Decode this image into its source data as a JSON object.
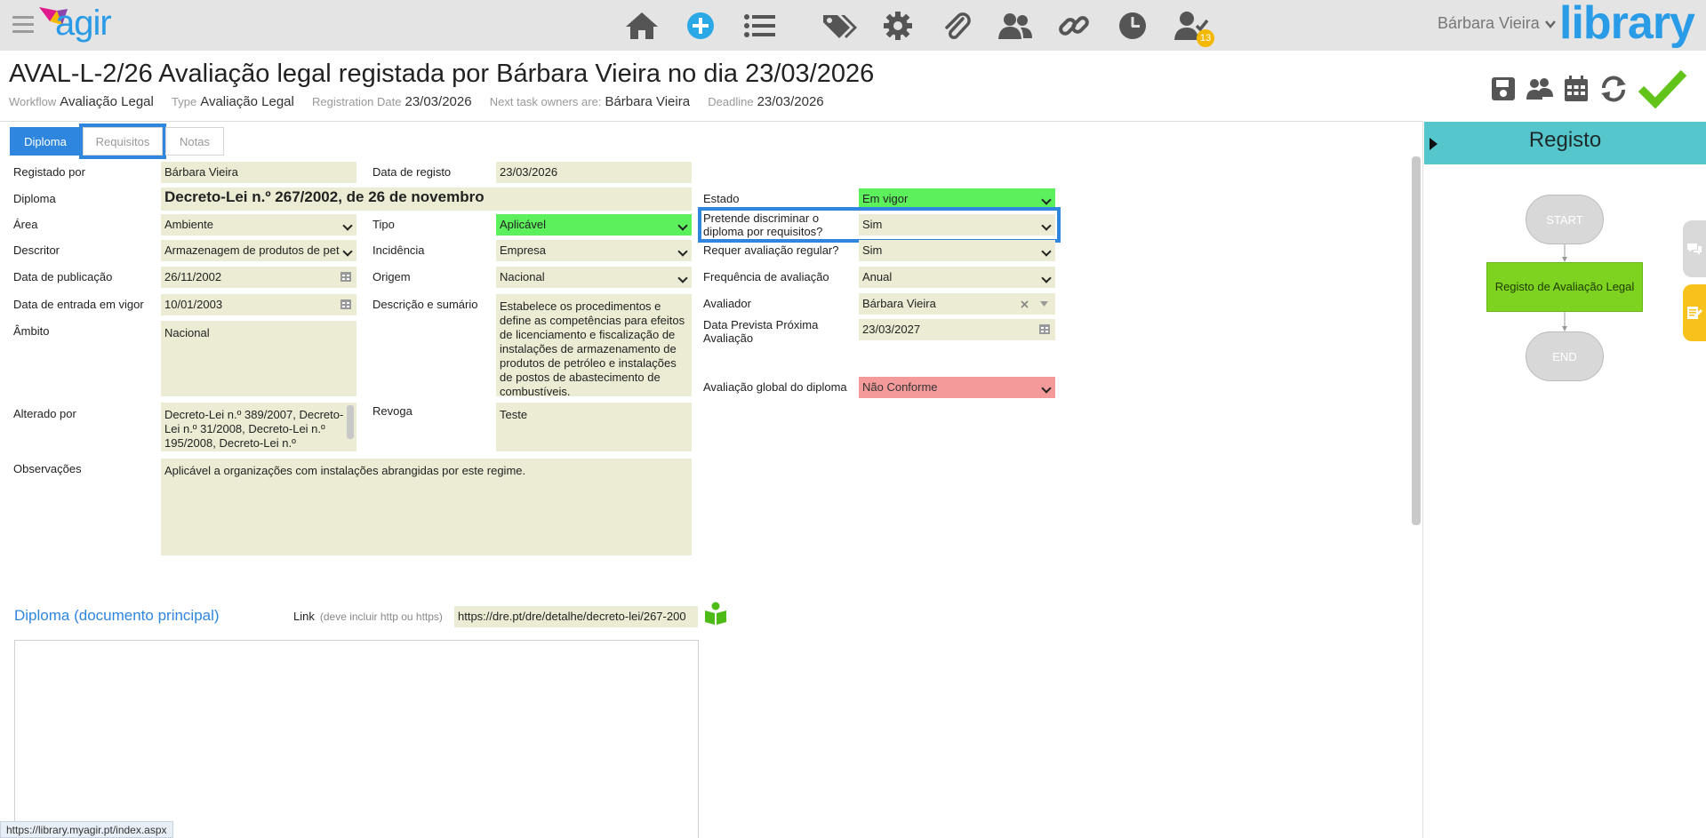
{
  "header": {
    "logo_text": "agir",
    "brand_text": "library",
    "user_name": "Bárbara Vieira",
    "notification_count": "13"
  },
  "nav_icons": [
    "home-icon",
    "add-icon",
    "list-icon",
    "tags-icon",
    "gear-icon",
    "paperclip-icon",
    "users-icon",
    "link-icon",
    "clock-icon",
    "user-check-icon"
  ],
  "record": {
    "title": "AVAL-L-2/26 Avaliação legal registada por Bárbara Vieira no dia 23/03/2026",
    "meta": {
      "workflow_label": "Workflow",
      "workflow_value": "Avaliação Legal",
      "type_label": "Type",
      "type_value": "Avaliação Legal",
      "regdate_label": "Registration Date",
      "regdate_value": "23/03/2026",
      "owners_label": "Next task owners are:",
      "owners_value": "Bárbara Vieira",
      "deadline_label": "Deadline",
      "deadline_value": "23/03/2026"
    }
  },
  "actions": [
    "save-icon",
    "team-icon",
    "calendar-icon",
    "refresh-icon",
    "check-icon"
  ],
  "tabs": [
    {
      "label": "Diploma",
      "active": true
    },
    {
      "label": "Requisitos",
      "active": false
    },
    {
      "label": "Notas",
      "active": false
    }
  ],
  "form": {
    "registado_por": {
      "label": "Registado por",
      "value": "Bárbara Vieira"
    },
    "data_registo": {
      "label": "Data de registo",
      "value": "23/03/2026"
    },
    "diploma": {
      "label": "Diploma",
      "value": "Decreto-Lei n.º 267/2002, de 26 de novembro"
    },
    "estado": {
      "label": "Estado",
      "value": "Em vigor"
    },
    "area": {
      "label": "Área",
      "value": "Ambiente"
    },
    "tipo": {
      "label": "Tipo",
      "value": "Aplicável"
    },
    "discriminar": {
      "label": "Pretende discriminar o diploma por requisitos?",
      "value": "Sim"
    },
    "descritor": {
      "label": "Descritor",
      "value": "Armazenagem de produtos de pet"
    },
    "incidencia": {
      "label": "Incidência",
      "value": "Empresa"
    },
    "requer": {
      "label": "Requer avaliação regular?",
      "value": "Sim"
    },
    "data_publicacao": {
      "label": "Data de publicação",
      "value": "26/11/2002"
    },
    "origem": {
      "label": "Origem",
      "value": "Nacional"
    },
    "frequencia": {
      "label": "Frequência de avaliação",
      "value": "Anual"
    },
    "data_entrada": {
      "label": "Data de entrada em vigor",
      "value": "10/01/2003"
    },
    "descricao": {
      "label": "Descrição e sumário",
      "value": "Estabelece os procedimentos e define as competências para efeitos de licenciamento e fiscalização de instalações de armazenamento de produtos de petróleo e instalações de postos de abastecimento de combustíveis."
    },
    "avaliador": {
      "label": "Avaliador",
      "value": "Bárbara Vieira"
    },
    "data_prevista": {
      "label": "Data Prevista Próxima Avaliação",
      "value": "23/03/2027"
    },
    "ambito": {
      "label": "Âmbito",
      "value": "Nacional"
    },
    "avaliacao_global": {
      "label": "Avaliação global do diploma",
      "value": "Não Conforme"
    },
    "alterado_por": {
      "label": "Alterado por",
      "value": "Decreto-Lei n.º 389/2007, Decreto-Lei n.º 31/2008, Decreto-Lei n.º 195/2008, Decreto-Lei n.º"
    },
    "revoga": {
      "label": "Revoga",
      "value": "Teste"
    },
    "observacoes": {
      "label": "Observações",
      "value": "Aplicável a organizações com instalações abrangidas por este regime."
    }
  },
  "document": {
    "title": "Diploma (documento principal)",
    "link_label": "Link",
    "link_hint": "(deve incluir http ou https)",
    "link_value": "https://dre.pt/dre/detalhe/decreto-lei/267-200"
  },
  "workflow_panel": {
    "title": "Registo",
    "start": "START",
    "task": "Registo de Avaliação Legal",
    "end": "END"
  },
  "status_bar_url": "https://library.myagir.pt/index.aspx",
  "colors": {
    "accent": "#2e86de",
    "field_bg": "#ececd4",
    "green": "#5cf05c",
    "red": "#f59a9a",
    "workflow_header": "#55c6cc",
    "task_green": "#7ed321"
  }
}
